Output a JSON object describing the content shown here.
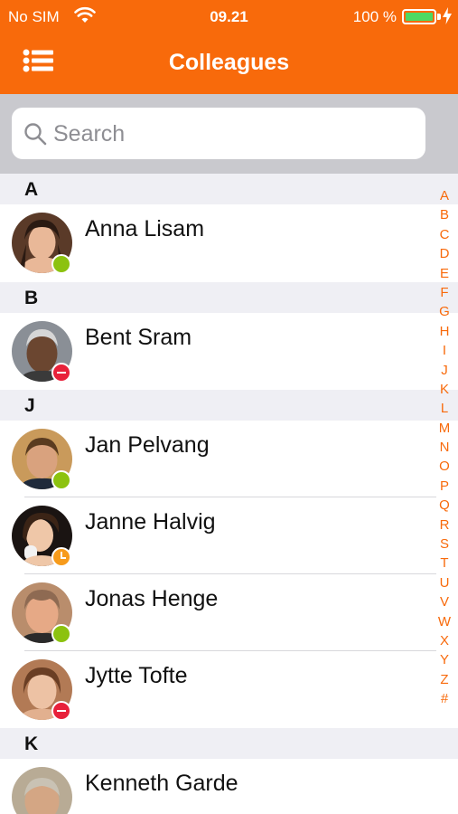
{
  "status_bar": {
    "carrier": "No SIM",
    "time": "09.21",
    "battery": "100 %"
  },
  "nav": {
    "title": "Colleagues",
    "menu_icon": "list-menu-icon"
  },
  "search": {
    "placeholder": "Search",
    "value": ""
  },
  "sections": [
    {
      "letter": "A",
      "contacts": [
        {
          "name": "Anna Lisam",
          "status": "available"
        }
      ]
    },
    {
      "letter": "B",
      "contacts": [
        {
          "name": "Bent Sram",
          "status": "busy"
        }
      ]
    },
    {
      "letter": "J",
      "contacts": [
        {
          "name": "Jan Pelvang",
          "status": "available"
        },
        {
          "name": "Janne Halvig",
          "status": "away"
        },
        {
          "name": "Jonas Henge",
          "status": "available"
        },
        {
          "name": "Jytte Tofte",
          "status": "busy"
        }
      ]
    },
    {
      "letter": "K",
      "contacts": [
        {
          "name": "Kenneth Garde",
          "status": ""
        }
      ]
    }
  ],
  "index_letters": [
    "A",
    "B",
    "C",
    "D",
    "E",
    "F",
    "G",
    "H",
    "I",
    "J",
    "K",
    "L",
    "M",
    "N",
    "O",
    "P",
    "Q",
    "R",
    "S",
    "T",
    "U",
    "V",
    "W",
    "X",
    "Y",
    "Z",
    "#"
  ],
  "colors": {
    "accent": "#f86a0b",
    "available": "#8cc20f",
    "busy": "#e8213a",
    "away": "#f79b1b"
  }
}
